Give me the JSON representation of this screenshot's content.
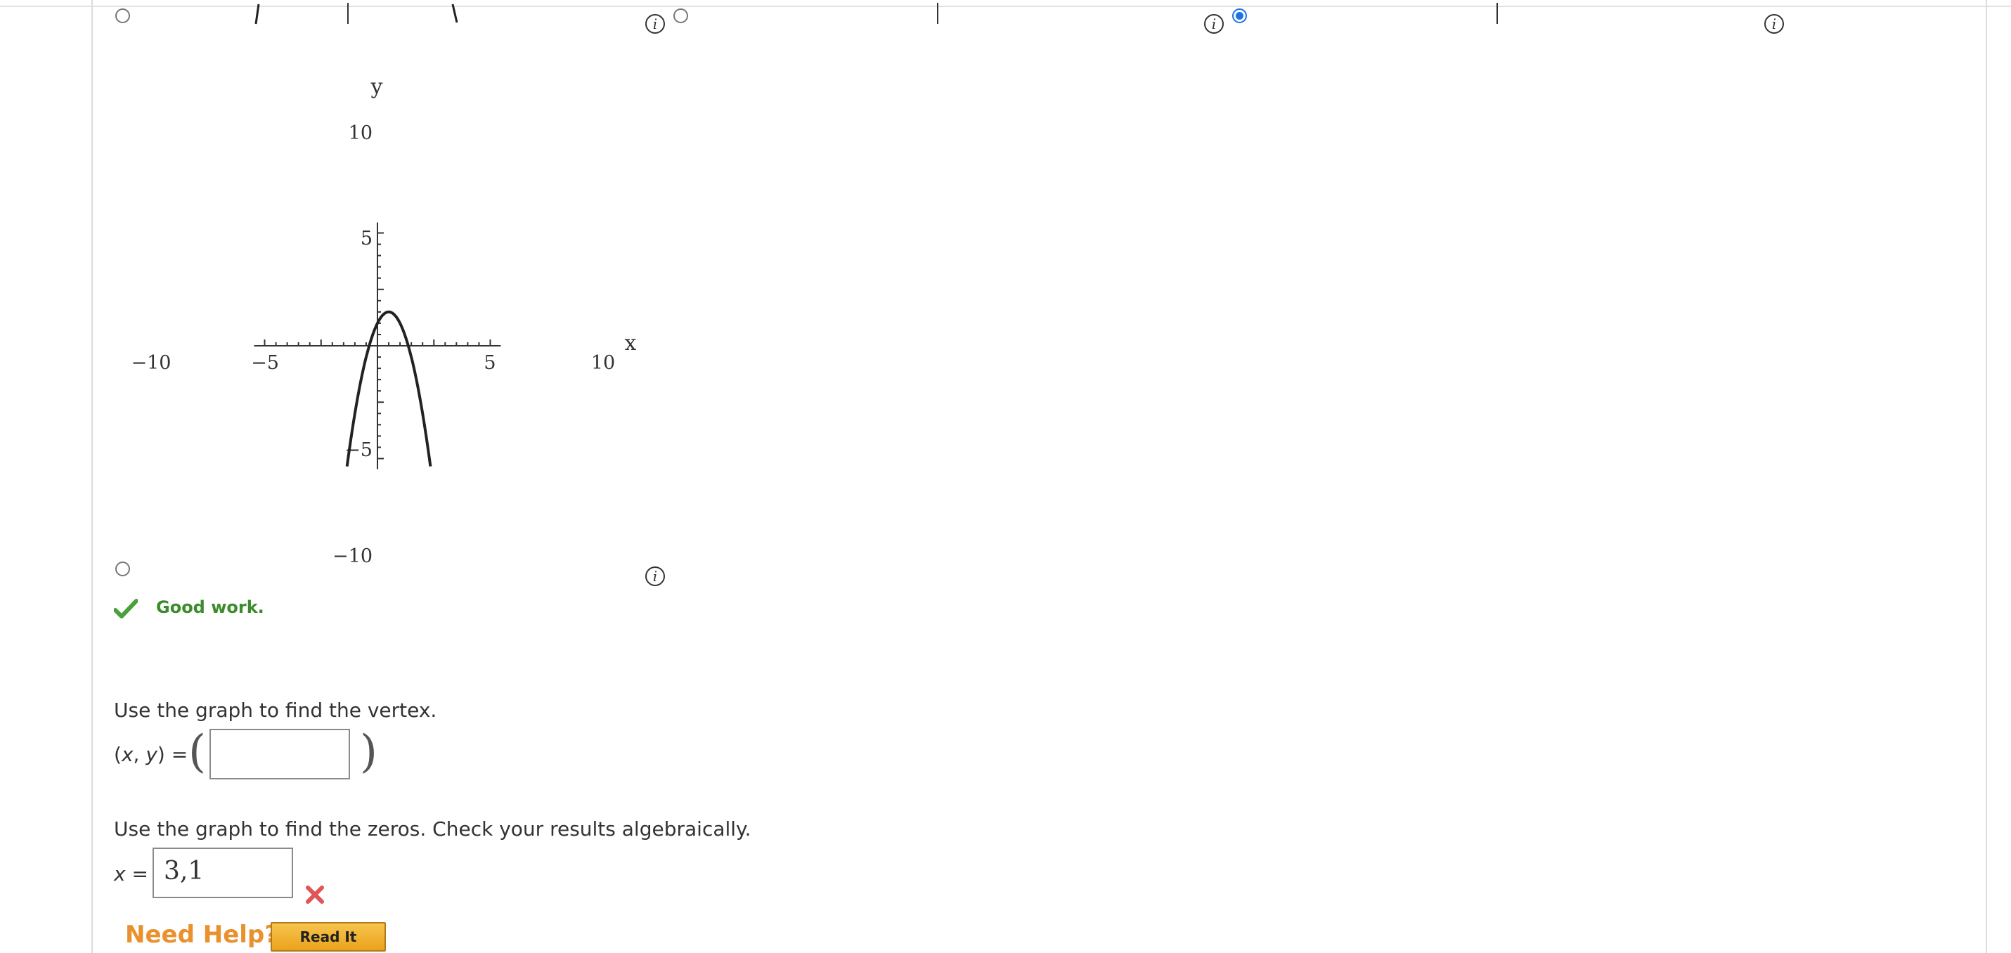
{
  "top_partial": {
    "tick_fragment": "10"
  },
  "options": {
    "info_glyph": "i",
    "icon_names": [
      "info-icon",
      "radio-button"
    ],
    "selected_option_index": 2
  },
  "graph": {
    "axis_x_label": "x",
    "axis_y_label": "y",
    "x_tick_labels": [
      "−10",
      "−5",
      "5",
      "10"
    ],
    "y_tick_labels": [
      "10",
      "5",
      "−5",
      "−10"
    ]
  },
  "chart_data": {
    "type": "line",
    "title": "",
    "xlabel": "x",
    "ylabel": "y",
    "xlim": [
      -10,
      10
    ],
    "ylim": [
      -10,
      10
    ],
    "grid": false,
    "x_tick_labels": [
      "−10",
      "−5",
      "5",
      "10"
    ],
    "y_tick_labels": [
      "10",
      "5",
      "−5",
      "−10"
    ],
    "series": [
      {
        "x": [
          -4,
          -3,
          -2,
          -1,
          0,
          1,
          2,
          3,
          4,
          5,
          6
        ],
        "y": [
          -22,
          -13,
          -6,
          -1,
          2,
          3,
          2,
          -1,
          -6,
          -13,
          -22
        ],
        "color": "#222222"
      }
    ]
  },
  "feedback": {
    "text": "Good work.",
    "icon": "check-icon",
    "color": "#3c8c2c"
  },
  "vertex_question": {
    "prompt": "Use the graph to find the vertex.",
    "label_prefix": "(",
    "label_x": "x",
    "label_sep": ", ",
    "label_y": "y",
    "label_suffix": ") =",
    "open_paren": "(",
    "close_paren": ")",
    "value": ""
  },
  "zeros_question": {
    "prompt": "Use the graph to find the zeros. Check your results algebraically.",
    "label_var": "x",
    "label_eq": " =",
    "value": "3,1",
    "status_icon": "wrong-icon"
  },
  "help": {
    "label": "Need Help?",
    "read_it_button": "Read It",
    "accent_color": "#e8912d"
  }
}
